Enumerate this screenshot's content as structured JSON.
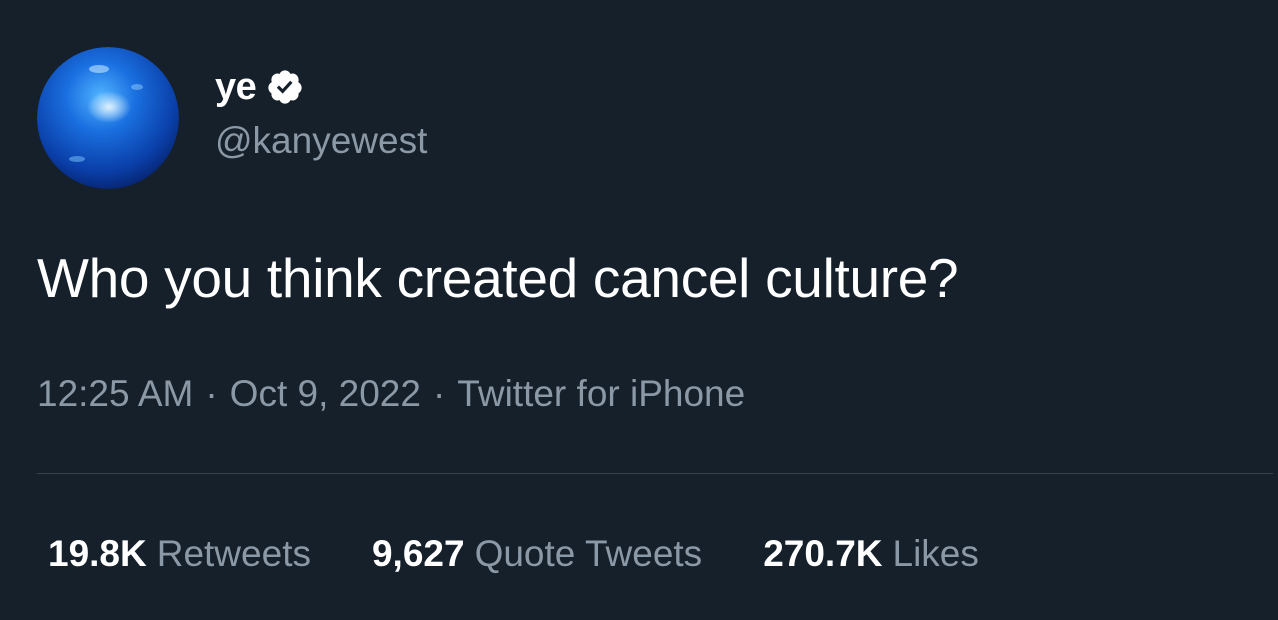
{
  "author": {
    "display_name": "ye",
    "handle": "@kanyewest",
    "verified": true,
    "avatar_icon": "blue-sphere-avatar"
  },
  "tweet": {
    "text": "Who you think created cancel culture?"
  },
  "meta": {
    "time": "12:25 AM",
    "date": "Oct 9, 2022",
    "source": "Twitter for iPhone",
    "separator": "·"
  },
  "stats": [
    {
      "count": "19.8K",
      "label": "Retweets"
    },
    {
      "count": "9,627",
      "label": "Quote Tweets"
    },
    {
      "count": "270.7K",
      "label": "Likes"
    }
  ],
  "colors": {
    "background": "#15202b",
    "primary_text": "#ffffff",
    "secondary_text": "#8b98a5",
    "divider": "#38444d"
  }
}
